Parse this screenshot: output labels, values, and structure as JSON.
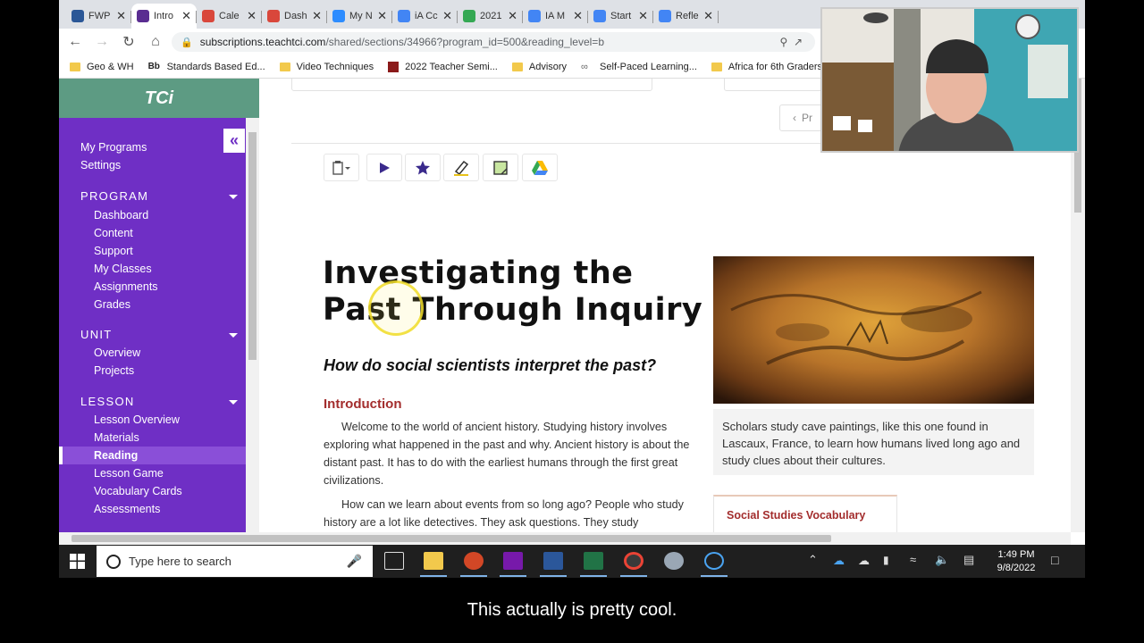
{
  "browser": {
    "tabs": [
      {
        "label": "FWP",
        "color": "#2b5797"
      },
      {
        "label": "Intro",
        "color": "#5a2d91",
        "active": true
      },
      {
        "label": "Cale",
        "color": "#d9473b"
      },
      {
        "label": "Dash",
        "color": "#d9473b"
      },
      {
        "label": "My N",
        "color": "#2d8cff"
      },
      {
        "label": "iA Cc",
        "color": "#4285f4"
      },
      {
        "label": "2021",
        "color": "#34a853"
      },
      {
        "label": "IA M",
        "color": "#4285f4"
      },
      {
        "label": "Start",
        "color": "#4285f4"
      },
      {
        "label": "Refle",
        "color": "#4285f4"
      }
    ],
    "url_host": "subscriptions.teachtci.com",
    "url_path": "/shared/sections/34966?program_id=500&reading_level=b",
    "bookmarks": [
      {
        "label": "Geo & WH",
        "icon": "folder"
      },
      {
        "label": "Standards Based Ed...",
        "icon": "Bb"
      },
      {
        "label": "Video Techniques",
        "icon": "folder"
      },
      {
        "label": "2022 Teacher Semi...",
        "icon": "G"
      },
      {
        "label": "Advisory",
        "icon": "folder"
      },
      {
        "label": "Self-Paced Learning...",
        "icon": "link"
      },
      {
        "label": "Africa for 6th Graders",
        "icon": "folder"
      }
    ]
  },
  "sidebar": {
    "logo": "TCi",
    "top_links": [
      "My Programs",
      "Settings"
    ],
    "sections": [
      {
        "heading": "PROGRAM",
        "items": [
          "Dashboard",
          "Content",
          "Support",
          "My Classes",
          "Assignments",
          "Grades"
        ]
      },
      {
        "heading": "UNIT",
        "items": [
          "Overview",
          "Projects"
        ]
      },
      {
        "heading": "LESSON",
        "items": [
          "Lesson Overview",
          "Materials",
          "Reading",
          "Lesson Game",
          "Vocabulary Cards",
          "Assessments"
        ]
      }
    ],
    "active_item": "Reading"
  },
  "content": {
    "prev_label": "Pr",
    "title": "Investigating the Past Through Inquiry",
    "essential_question": "How do social scientists interpret the past?",
    "intro_heading": "Introduction",
    "paragraphs": [
      "Welcome to the world of ancient history. Studying history involves exploring what happened in the past and why. Ancient history is about the distant past. It has to do with the earliest humans through the first great civilizations.",
      "How can we learn about events from so long ago? People who study history are a lot like detectives. They ask questions. They study"
    ],
    "photo_caption": "Scholars study cave paintings, like this one found in Lascaux, France, to learn how humans lived long ago and study clues about their cultures.",
    "vocab_box_title": "Social Studies Vocabulary"
  },
  "taskbar": {
    "search_placeholder": "Type here to search",
    "time": "1:49 PM",
    "date": "9/8/2022"
  },
  "subtitle": "This actually is pretty cool."
}
